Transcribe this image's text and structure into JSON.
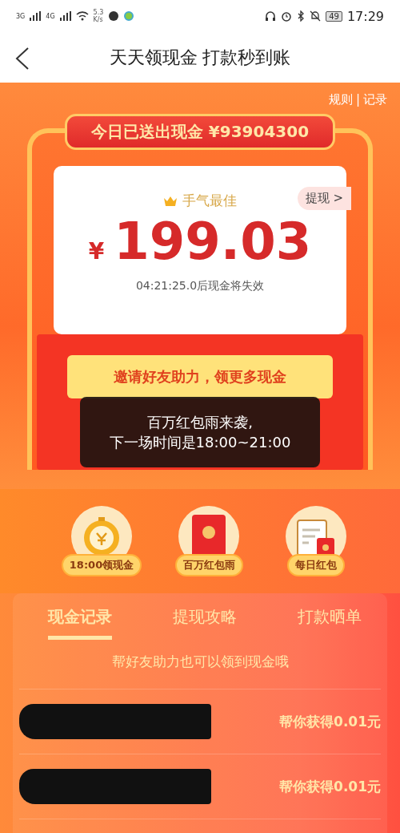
{
  "status_bar": {
    "network_1": "3G",
    "network_2": "4G",
    "speed": "5.3",
    "speed_unit": "K/s",
    "battery": "49",
    "time": "17:29"
  },
  "nav": {
    "title": "天天领现金 打款秒到账"
  },
  "top_links": [
    "规则",
    "|",
    "记录"
  ],
  "banner": {
    "text": "今日已送出现金 ¥93904300"
  },
  "envelope": {
    "badge": "手气最佳",
    "withdraw": "提现 >",
    "currency": "¥",
    "amount": "199.03",
    "expiry": "04:21:25.0后现金将失效",
    "invite": "邀请好友助力，领更多现金"
  },
  "toast": {
    "lines": [
      "百万红包雨来袭,",
      "下一场时间是18:00~21:00"
    ]
  },
  "features": [
    {
      "kind": "clock",
      "label": "18:00领现金"
    },
    {
      "kind": "envelope",
      "label": "百万红包雨"
    },
    {
      "kind": "calendar",
      "label": "每日红包"
    }
  ],
  "tabs": [
    {
      "label": "现金记录",
      "selected": true
    },
    {
      "label": "提现攻略",
      "selected": false
    },
    {
      "label": "打款晒单",
      "selected": false
    }
  ],
  "hint": "帮好友助力也可以领到现金哦",
  "records": [
    {
      "amount": "帮你获得0.01元"
    },
    {
      "amount": "帮你获得0.01元"
    }
  ]
}
